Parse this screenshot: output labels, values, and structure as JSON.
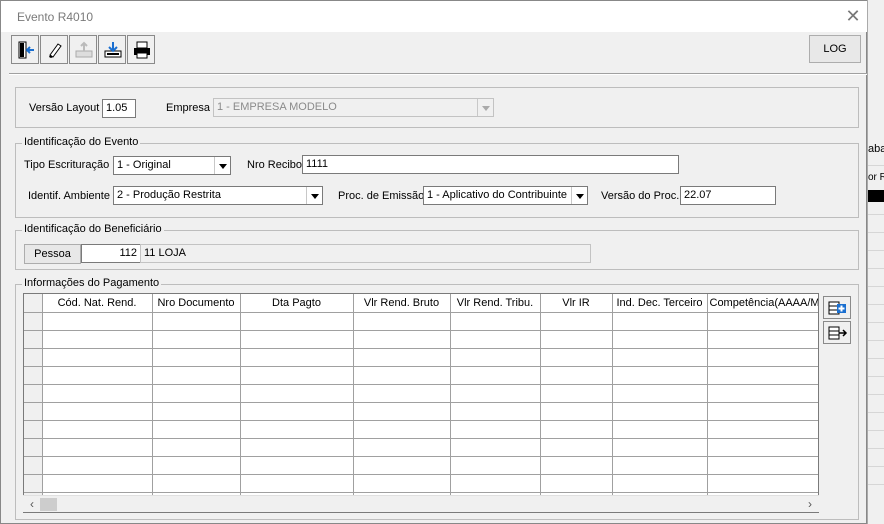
{
  "window": {
    "title": "Evento R4010",
    "close_icon": "close-icon"
  },
  "background": {
    "text1": "aba",
    "text2": "or R"
  },
  "toolbar": {
    "buttons": [
      {
        "name": "exit-door-icon"
      },
      {
        "name": "eraser-icon"
      },
      {
        "name": "import-disabled-icon"
      },
      {
        "name": "save-download-icon"
      },
      {
        "name": "print-icon"
      }
    ],
    "log_label": "LOG"
  },
  "header": {
    "versao_layout_label": "Versão Layout",
    "versao_layout_value": "1.05",
    "empresa_label": "Empresa",
    "empresa_value": "1 - EMPRESA MODELO"
  },
  "evento": {
    "title": "Identificação do Evento",
    "tipo_escrituracao_label": "Tipo Escrituração",
    "tipo_escrituracao_value": "1 - Original",
    "nro_recibo_label": "Nro Recibo",
    "nro_recibo_value": "1111",
    "ambiente_label": "Identif. Ambiente",
    "ambiente_value": "2 - Produção Restrita",
    "proc_emissao_label": "Proc. de Emissão",
    "proc_emissao_value": "1 - Aplicativo do Contribuinte",
    "versao_proc_label": "Versão do Proc.",
    "versao_proc_value": "22.07"
  },
  "beneficiario": {
    "title": "Identificação do Beneficiário",
    "pessoa_button": "Pessoa",
    "codigo": "112",
    "nome": "11 LOJA"
  },
  "pagamento": {
    "title": "Informações do Pagamento",
    "columns": [
      "Cód. Nat. Rend.",
      "Nro Documento",
      "Dta Pagto",
      "Vlr Rend. Bruto",
      "Vlr Rend. Tribu.",
      "Vlr IR",
      "Ind. Dec. Terceiro",
      "Competência(AAAA/M"
    ],
    "row_count": 11,
    "scroll_left": "‹",
    "scroll_right": "›"
  }
}
